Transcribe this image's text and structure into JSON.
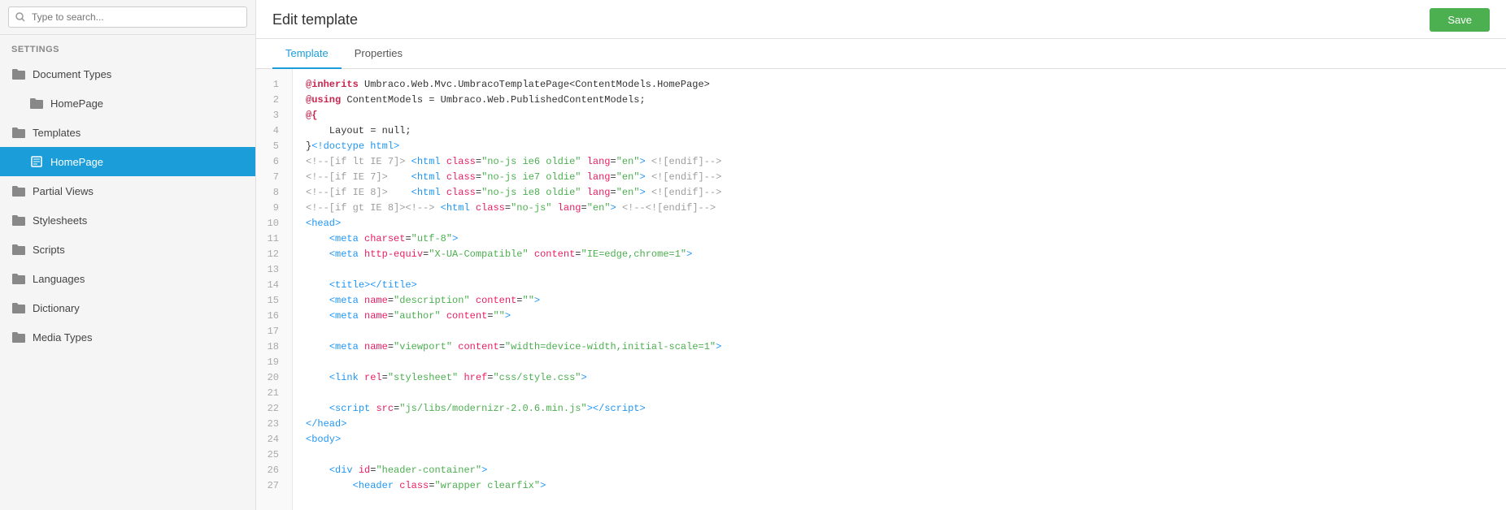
{
  "sidebar": {
    "search_placeholder": "Type to search...",
    "settings_label": "SETTINGS",
    "nav_items": [
      {
        "id": "document-types",
        "label": "Document Types",
        "type": "folder",
        "level": 0,
        "active": false
      },
      {
        "id": "homepage-doc",
        "label": "HomePage",
        "type": "folder",
        "level": 1,
        "active": false
      },
      {
        "id": "templates",
        "label": "Templates",
        "type": "folder",
        "level": 0,
        "active": false
      },
      {
        "id": "homepage-template",
        "label": "HomePage",
        "type": "template",
        "level": 1,
        "active": true
      },
      {
        "id": "partial-views",
        "label": "Partial Views",
        "type": "folder",
        "level": 0,
        "active": false
      },
      {
        "id": "stylesheets",
        "label": "Stylesheets",
        "type": "folder",
        "level": 0,
        "active": false
      },
      {
        "id": "scripts",
        "label": "Scripts",
        "type": "folder",
        "level": 0,
        "active": false
      },
      {
        "id": "languages",
        "label": "Languages",
        "type": "folder",
        "level": 0,
        "active": false
      },
      {
        "id": "dictionary",
        "label": "Dictionary",
        "type": "folder",
        "level": 0,
        "active": false
      },
      {
        "id": "media-types",
        "label": "Media Types",
        "type": "folder",
        "level": 0,
        "active": false
      }
    ]
  },
  "header": {
    "title": "Edit template",
    "save_label": "Save"
  },
  "tabs": [
    {
      "id": "template",
      "label": "Template",
      "active": true
    },
    {
      "id": "properties",
      "label": "Properties",
      "active": false
    }
  ],
  "editor": {
    "lines": [
      {
        "num": 1,
        "html": "<span class='razor'>@inherits</span> Umbraco.Web.Mvc.UmbracoTemplatePage&lt;ContentModels.HomePage&gt;"
      },
      {
        "num": 2,
        "html": "<span class='razor'>@using</span> ContentModels = Umbraco.Web.PublishedContentModels;"
      },
      {
        "num": 3,
        "html": "<span class='razor'>@{</span>"
      },
      {
        "num": 4,
        "html": "    Layout = null;"
      },
      {
        "num": 5,
        "html": "}<span class='tag'>&lt;!doctype html&gt;</span>"
      },
      {
        "num": 6,
        "html": "<span class='comment'>&lt;!--[if lt IE 7]&gt;</span> <span class='tag'>&lt;html</span> <span class='attr'>class</span>=<span class='val'>\"no-js ie6 oldie\"</span> <span class='attr'>lang</span>=<span class='val'>\"en\"</span><span class='tag'>&gt;</span> <span class='comment'>&lt;![endif]--&gt;</span>"
      },
      {
        "num": 7,
        "html": "<span class='comment'>&lt;!--[if IE 7]&gt;</span>    <span class='tag'>&lt;html</span> <span class='attr'>class</span>=<span class='val'>\"no-js ie7 oldie\"</span> <span class='attr'>lang</span>=<span class='val'>\"en\"</span><span class='tag'>&gt;</span> <span class='comment'>&lt;![endif]--&gt;</span>"
      },
      {
        "num": 8,
        "html": "<span class='comment'>&lt;!--[if IE 8]&gt;</span>    <span class='tag'>&lt;html</span> <span class='attr'>class</span>=<span class='val'>\"no-js ie8 oldie\"</span> <span class='attr'>lang</span>=<span class='val'>\"en\"</span><span class='tag'>&gt;</span> <span class='comment'>&lt;![endif]--&gt;</span>"
      },
      {
        "num": 9,
        "html": "<span class='comment'>&lt;!--[if gt IE 8]&gt;&lt;!--&gt;</span> <span class='tag'>&lt;html</span> <span class='attr'>class</span>=<span class='val'>\"no-js\"</span> <span class='attr'>lang</span>=<span class='val'>\"en\"</span><span class='tag'>&gt;</span> <span class='comment'>&lt;!--&lt;![endif]--&gt;</span>"
      },
      {
        "num": 10,
        "html": "<span class='tag'>&lt;head&gt;</span>"
      },
      {
        "num": 11,
        "html": "    <span class='tag'>&lt;meta</span> <span class='attr'>charset</span>=<span class='val'>\"utf-8\"</span><span class='tag'>&gt;</span>"
      },
      {
        "num": 12,
        "html": "    <span class='tag'>&lt;meta</span> <span class='attr'>http-equiv</span>=<span class='val'>\"X-UA-Compatible\"</span> <span class='attr'>content</span>=<span class='val'>\"IE=edge,chrome=1\"</span><span class='tag'>&gt;</span>"
      },
      {
        "num": 13,
        "html": ""
      },
      {
        "num": 14,
        "html": "    <span class='tag'>&lt;title&gt;&lt;/title&gt;</span>"
      },
      {
        "num": 15,
        "html": "    <span class='tag'>&lt;meta</span> <span class='attr'>name</span>=<span class='val'>\"description\"</span> <span class='attr'>content</span>=<span class='val'>\"\"</span><span class='tag'>&gt;</span>"
      },
      {
        "num": 16,
        "html": "    <span class='tag'>&lt;meta</span> <span class='attr'>name</span>=<span class='val'>\"author\"</span> <span class='attr'>content</span>=<span class='val'>\"\"</span><span class='tag'>&gt;</span>"
      },
      {
        "num": 17,
        "html": ""
      },
      {
        "num": 18,
        "html": "    <span class='tag'>&lt;meta</span> <span class='attr'>name</span>=<span class='val'>\"viewport\"</span> <span class='attr'>content</span>=<span class='val'>\"width=device-width,initial-scale=1\"</span><span class='tag'>&gt;</span>"
      },
      {
        "num": 19,
        "html": ""
      },
      {
        "num": 20,
        "html": "    <span class='tag'>&lt;link</span> <span class='attr'>rel</span>=<span class='val'>\"stylesheet\"</span> <span class='attr'>href</span>=<span class='val'>\"css/style.css\"</span><span class='tag'>&gt;</span>"
      },
      {
        "num": 21,
        "html": ""
      },
      {
        "num": 22,
        "html": "    <span class='tag'>&lt;script</span> <span class='attr'>src</span>=<span class='val'>\"js/libs/modernizr-2.0.6.min.js\"</span><span class='tag'>&gt;&lt;/script&gt;</span>"
      },
      {
        "num": 23,
        "html": "<span class='tag'>&lt;/head&gt;</span>"
      },
      {
        "num": 24,
        "html": "<span class='tag'>&lt;body&gt;</span>"
      },
      {
        "num": 25,
        "html": ""
      },
      {
        "num": 26,
        "html": "    <span class='tag'>&lt;div</span> <span class='attr'>id</span>=<span class='val'>\"header-container\"</span><span class='tag'>&gt;</span>"
      },
      {
        "num": 27,
        "html": "        <span class='tag'>&lt;header</span> <span class='attr'>class</span>=<span class='val'>\"wrapper clearfix\"</span><span class='tag'>&gt;</span>"
      }
    ]
  },
  "colors": {
    "active_bg": "#1b9dd9",
    "save_btn": "#4caf50",
    "accent": "#1b9dd9"
  }
}
